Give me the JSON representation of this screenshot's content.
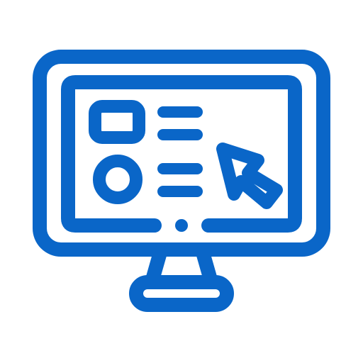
{
  "icon": {
    "name": "computer-monitor-with-cursor-icon",
    "stroke_color": "#0a66c8",
    "background": "#ffffff"
  }
}
